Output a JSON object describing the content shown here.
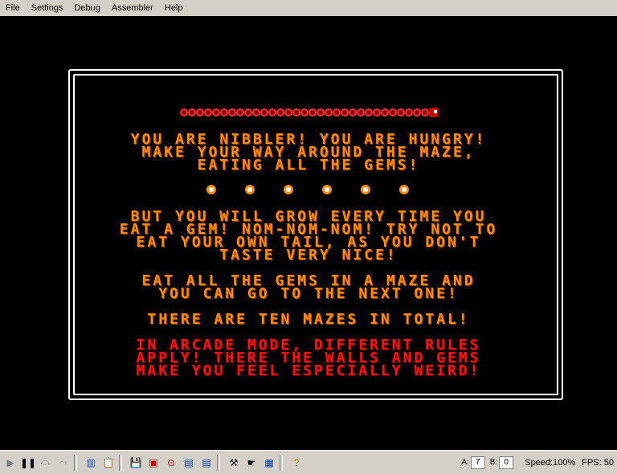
{
  "menu": [
    "File",
    "Settings",
    "Debug",
    "Assembler",
    "Help"
  ],
  "game": {
    "para1": [
      "YOU ARE NIBBLER! YOU ARE HUNGRY!",
      "MAKE YOUR WAY AROUND THE MAZE,",
      "EATING ALL THE GEMS!"
    ],
    "para2": [
      "BUT YOU WILL GROW EVERY TIME YOU",
      "EAT A GEM! NOM-NOM-NOM! TRY NOT TO",
      "EAT YOUR OWN TAIL, AS YOU DON'T",
      "TASTE VERY NICE!"
    ],
    "para3": [
      "EAT ALL THE GEMS IN A MAZE AND",
      "YOU CAN GO TO THE NEXT ONE!"
    ],
    "para4": "THERE ARE TEN MAZES IN TOTAL!",
    "para5": [
      "IN ARCADE MODE, DIFFERENT RULES",
      "APPLY! THERE THE WALLS AND GEMS",
      "MAKE YOU FEEL ESPECIALLY WEIRD!"
    ],
    "colors": {
      "orange": "#ff8c00",
      "red": "#ff1010",
      "snake": "#d00000"
    }
  },
  "status": {
    "reg_a_label": "A:",
    "reg_a_value": "7",
    "reg_b_label": "B:",
    "reg_b_value": "0",
    "speed": "Speed:100%",
    "fps": "FPS: 50"
  }
}
